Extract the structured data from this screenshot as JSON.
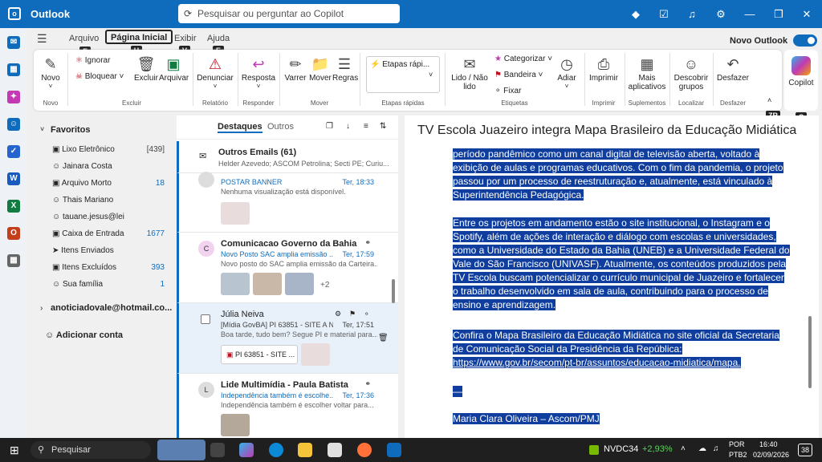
{
  "app": {
    "name": "Outlook",
    "search_placeholder": "Pesquisar ou perguntar ao Copilot"
  },
  "tabs": [
    "Arquivo",
    "Página Inicial",
    "Exibir",
    "Ajuda"
  ],
  "new_outlook": "Novo Outlook",
  "ribbon": {
    "novo": "Novo",
    "ignorar": "Ignorar",
    "bloquear": "Bloquear",
    "excluir": "Excluir",
    "arquivar": "Arquivar",
    "denunciar": "Denunciar",
    "resposta": "Resposta",
    "varrer": "Varrer",
    "mover": "Mover",
    "regras": "Regras",
    "etapas": "Etapas rápi...",
    "lido": "Lido / Não lido",
    "categorizar": "Categorizar",
    "bandeira": "Bandeira",
    "fixar": "Fixar",
    "adiar": "Adiar",
    "imprimir": "Imprimir",
    "mais_apps": "Mais aplicativos",
    "descobrir": "Descobrir grupos",
    "desfazer": "Desfazer",
    "copilot": "Copilot",
    "groups": {
      "novo": "Novo",
      "excluir": "Excluir",
      "relatorio": "Relatório",
      "responder": "Responder",
      "mover": "Mover",
      "etapas": "Etapas rápidas",
      "etiquetas": "Etiquetas",
      "imprimir": "Imprimir",
      "suplementos": "Suplementos",
      "localizar": "Localizar",
      "desfazer": "Desfazer"
    },
    "keytips": {
      "f": "F",
      "h": "H",
      "v": "V",
      "e": "E",
      "zr": "ZR",
      "c": "C"
    }
  },
  "folders": {
    "favoritos": "Favoritos",
    "items": [
      {
        "label": "Lixo Eletrônico",
        "count": "[439]"
      },
      {
        "label": "Jainara Costa",
        "count": ""
      },
      {
        "label": "Arquivo Morto",
        "count": "18"
      },
      {
        "label": "Thais Mariano",
        "count": ""
      },
      {
        "label": "tauane.jesus@lei",
        "count": ""
      },
      {
        "label": "Caixa de Entrada",
        "count": "1677"
      },
      {
        "label": "Itens Enviados",
        "count": ""
      },
      {
        "label": "Itens Excluídos",
        "count": "393"
      },
      {
        "label": "Sua família",
        "count": "1"
      }
    ],
    "account": "anoticiadovale@hotmail.co...",
    "add_account": "Adicionar conta"
  },
  "list": {
    "tab_focused": "Destaques",
    "tab_other": "Outros",
    "other_emails": {
      "title": "Outros Emails (61)",
      "preview": "Helder Azevedo; ASCOM Petrolina; Secti PE; Curiu..."
    },
    "messages": [
      {
        "sender": "",
        "subject": "POSTAR BANNER",
        "time": "Ter, 18:33",
        "preview": "Nenhuma visualização está disponível."
      },
      {
        "sender": "Comunicacao Governo da Bahia",
        "subject": "Novo Posto SAC amplia emissão ...",
        "time": "Ter, 17:59",
        "preview": "Novo posto do SAC amplia emissão da Carteira...",
        "more": "+2",
        "initial": "C"
      },
      {
        "sender": "Júlia Neiva",
        "subject": "[Mídia GovBA] PI 63851 - SITE A N...",
        "time": "Ter, 17:51",
        "preview": "Boa tarde, tudo bem? Segue PI e material para...",
        "attachment": "PI 63851 - SITE ..."
      },
      {
        "sender": "Lide Multimídia - Paula Batista",
        "subject": "Independência também é escolhe...",
        "time": "Ter, 17:36",
        "preview": "Independência também é escolher voltar para...",
        "initial": "L"
      }
    ]
  },
  "reading": {
    "title": "TV Escola Juazeiro integra Mapa Brasileiro da Educação Midiática",
    "p1": "período pandêmico como um canal digital de televisão aberta, voltado à exibição de aulas e programas educativos. Com o fim da pandemia, o projeto passou por um processo de reestruturação e, atualmente, está vinculado à Superintendência Pedagógica.",
    "p2": "Entre os projetos em andamento estão o site institucional, o Instagram e o Spotify, além de ações de interação e diálogo com escolas e universidades, como a Universidade do Estado da Bahia (UNEB) e a Universidade Federal do Vale do São Francisco (UNIVASF). Atualmente, os conteúdos produzidos pela TV Escola buscam potencializar o currículo municipal de Juazeiro e fortalecer o trabalho desenvolvido em sala de aula, contribuindo para o processo de ensino e aprendizagem.",
    "p3": "Confira o Mapa Brasileiro da Educação Midiática no site oficial da Secretaria de Comunicação Social da Presidência da República:",
    "link": "https://www.gov.br/secom/pt-br/assuntos/educacao-midiatica/mapa.",
    "dash": "—",
    "sign": "Maria Clara Oliveira – Ascom/PMJ"
  },
  "taskbar": {
    "search": "Pesquisar",
    "stock": "NVDC34",
    "stock_change": "+2,93%",
    "lang1": "POR",
    "lang2": "PTB2",
    "time": "16:40",
    "date": "02/09/2026",
    "notif": "38"
  },
  "colors": {
    "accent": "#0f6cbd",
    "highlight": "#0f3e9e",
    "taskbar": "#1f1f1f"
  }
}
